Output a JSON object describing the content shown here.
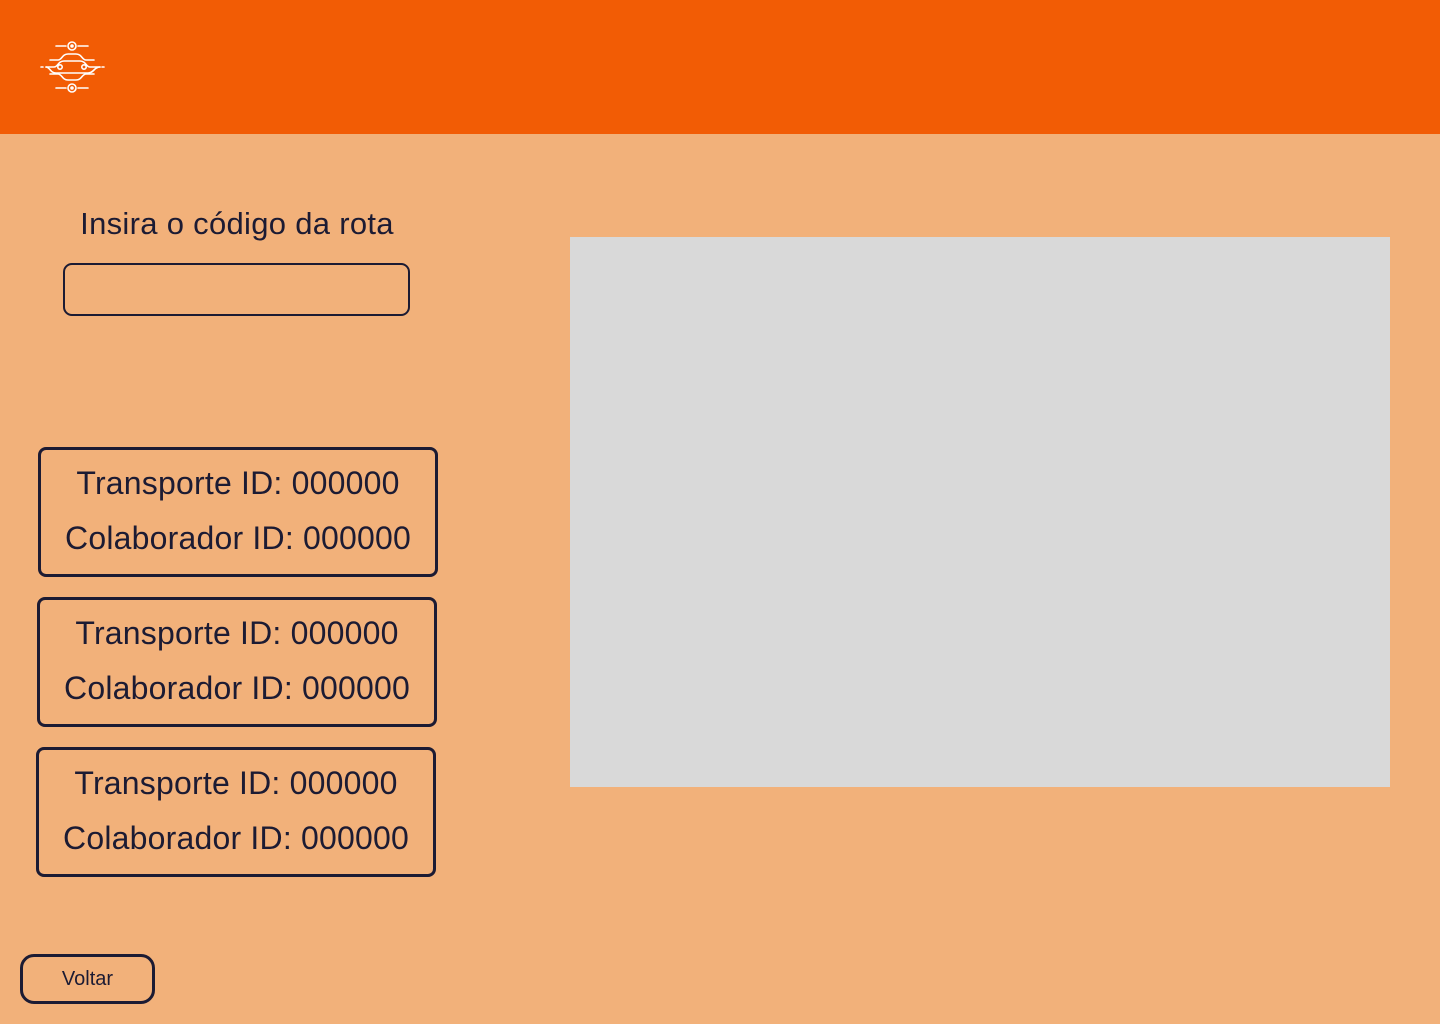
{
  "header": {
    "logo_icon": "circuit-route-logo-icon",
    "background_color": "#F25C05"
  },
  "route_search": {
    "label": "Insira o código da rota",
    "input_value": "",
    "placeholder": ""
  },
  "transports": [
    {
      "transport": "Transporte ID: 000000",
      "collaborator": "Colaborador ID: 000000"
    },
    {
      "transport": "Transporte ID: 000000",
      "collaborator": "Colaborador ID: 000000"
    },
    {
      "transport": "Transporte ID: 000000",
      "collaborator": "Colaborador ID: 000000"
    }
  ],
  "map": {
    "placeholder_color": "#D9D9D9"
  },
  "footer": {
    "back_label": "Voltar"
  },
  "colors": {
    "page_background": "#F2B17A",
    "accent": "#F25C05",
    "text": "#1C1B33"
  }
}
